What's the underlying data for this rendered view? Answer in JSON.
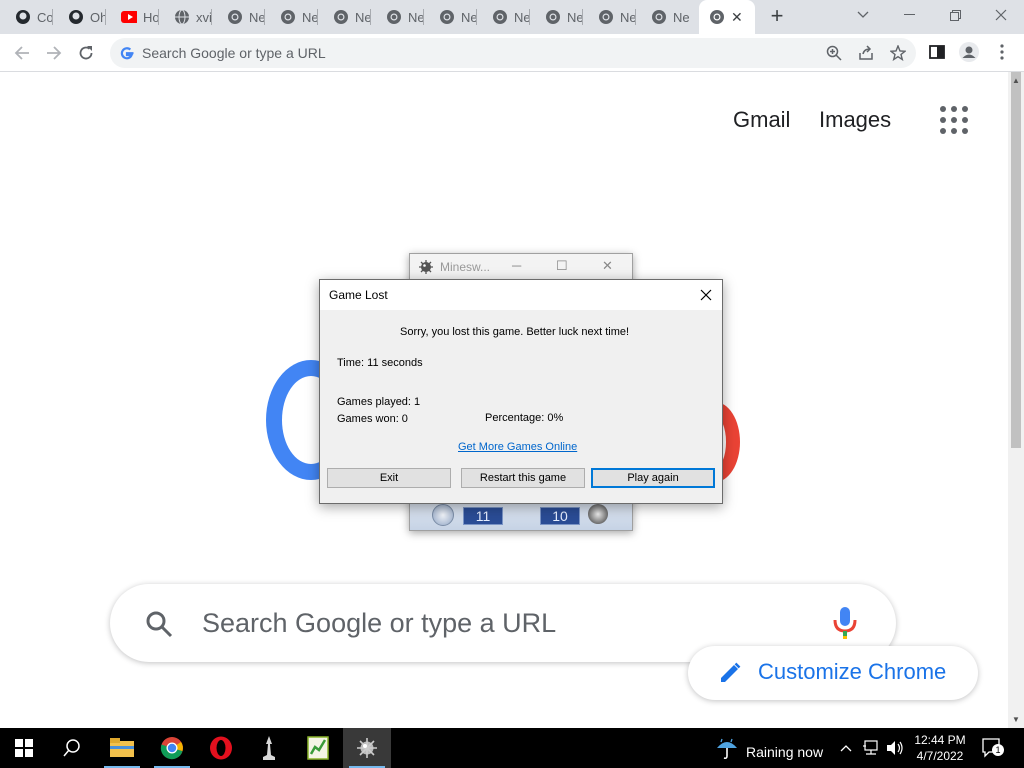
{
  "browser": {
    "tabs": [
      {
        "title": "Co",
        "icon": "github-icon"
      },
      {
        "title": "Oh",
        "icon": "github-icon"
      },
      {
        "title": "Ho",
        "icon": "youtube-icon"
      },
      {
        "title": "xvi",
        "icon": "globe-icon"
      },
      {
        "title": "Ne",
        "icon": "chrome-icon"
      },
      {
        "title": "Ne",
        "icon": "chrome-icon"
      },
      {
        "title": "Ne",
        "icon": "chrome-icon"
      },
      {
        "title": "Ne",
        "icon": "chrome-icon"
      },
      {
        "title": "Ne",
        "icon": "chrome-icon"
      },
      {
        "title": "Ne",
        "icon": "chrome-icon"
      },
      {
        "title": "Ne",
        "icon": "chrome-icon"
      },
      {
        "title": "Ne",
        "icon": "chrome-icon"
      },
      {
        "title": "Ne",
        "icon": "chrome-icon"
      }
    ],
    "omnibox_placeholder": "Search Google or type a URL"
  },
  "newtab": {
    "gmail": "Gmail",
    "images": "Images",
    "search_placeholder": "Search Google or type a URL",
    "customize": "Customize Chrome"
  },
  "minesweeper": {
    "title": "Minesw...",
    "time_counter": "11",
    "mine_counter": "10"
  },
  "dialog": {
    "title": "Game Lost",
    "message": "Sorry, you lost this game. Better luck next time!",
    "time": "Time: 11 seconds",
    "games_played": "Games played: 1",
    "games_won": "Games won: 0",
    "percentage": "Percentage: 0%",
    "link": "Get More Games Online",
    "buttons": {
      "exit": "Exit",
      "restart": "Restart this game",
      "play_again": "Play again"
    }
  },
  "taskbar": {
    "weather": "Raining now",
    "time": "12:44 PM",
    "date": "4/7/2022",
    "notifications": "1"
  }
}
